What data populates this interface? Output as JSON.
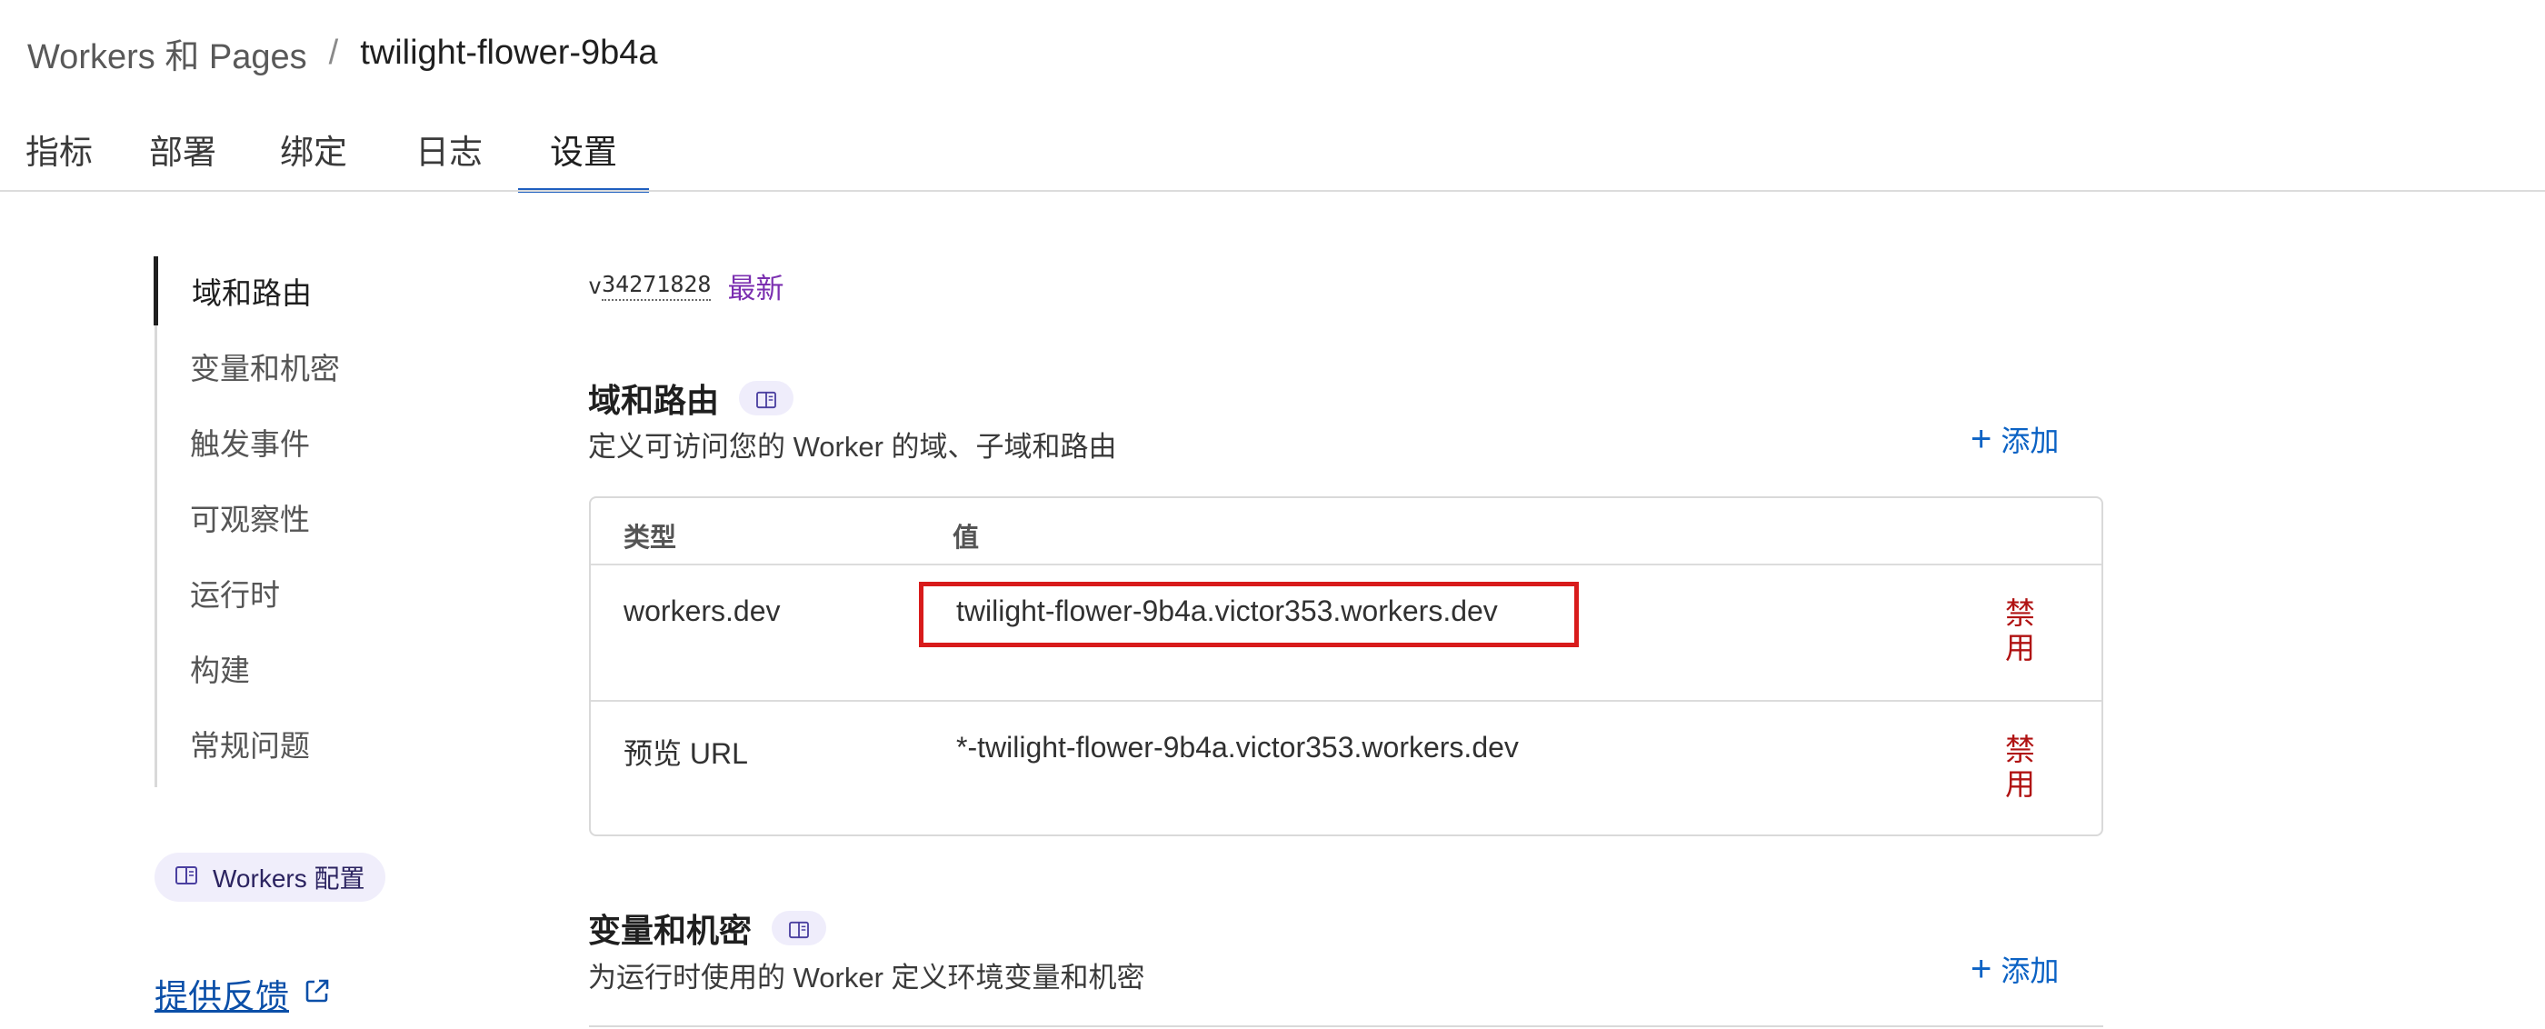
{
  "breadcrumb": {
    "parent": "Workers 和 Pages",
    "separator": "/",
    "current": "twilight-flower-9b4a"
  },
  "tabs": [
    {
      "label": "指标",
      "active": false
    },
    {
      "label": "部署",
      "active": false
    },
    {
      "label": "绑定",
      "active": false
    },
    {
      "label": "日志",
      "active": false
    },
    {
      "label": "设置",
      "active": true
    }
  ],
  "sidebar": {
    "items": [
      {
        "label": "域和路由",
        "active": true
      },
      {
        "label": "变量和机密",
        "active": false
      },
      {
        "label": "触发事件",
        "active": false
      },
      {
        "label": "可观察性",
        "active": false
      },
      {
        "label": "运行时",
        "active": false
      },
      {
        "label": "构建",
        "active": false
      },
      {
        "label": "常规问题",
        "active": false
      }
    ],
    "config_pill": {
      "label": "Workers 配置",
      "icon": "book-icon"
    },
    "feedback": {
      "label": "提供反馈",
      "icon": "external-link-icon"
    }
  },
  "version": {
    "prefix": "v",
    "number": "34271828",
    "badge": "最新"
  },
  "domains_section": {
    "title": "域和路由",
    "doc_icon": "book-icon",
    "description": "定义可访问您的 Worker 的域、子域和路由",
    "add_label": "添加",
    "table": {
      "headers": [
        "类型",
        "值"
      ],
      "rows": [
        {
          "type": "workers.dev",
          "value": "twilight-flower-9b4a.victor353.workers.dev",
          "action": "禁用",
          "highlighted": true
        },
        {
          "type": "预览 URL",
          "value": "*-twilight-flower-9b4a.victor353.workers.dev",
          "action": "禁用",
          "highlighted": false
        }
      ]
    }
  },
  "variables_section": {
    "title": "变量和机密",
    "doc_icon": "book-icon",
    "description": "为运行时使用的 Worker 定义环境变量和机密",
    "add_label": "添加"
  },
  "colors": {
    "accent_blue": "#1f5fbf",
    "link_blue": "#0b62c4",
    "danger_red": "#b01212",
    "highlight_red": "#d81b1b",
    "badge_purple": "#7b2fb0"
  }
}
